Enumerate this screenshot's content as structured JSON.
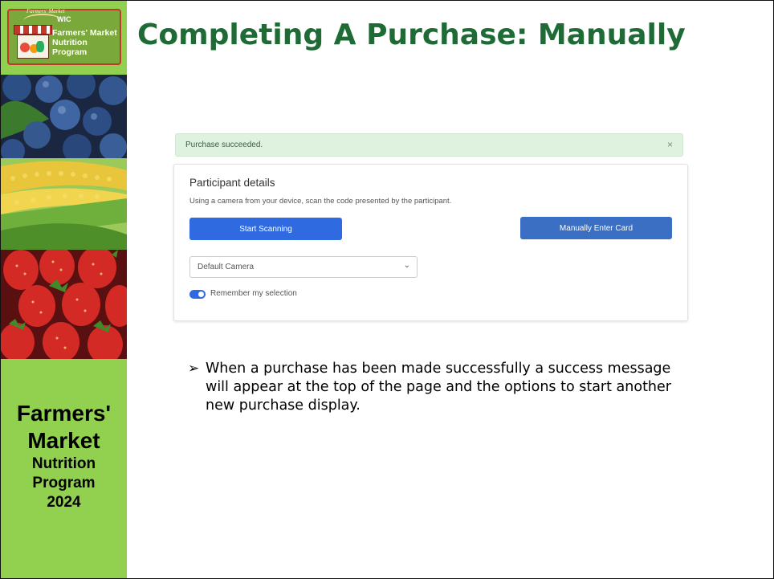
{
  "sidebar": {
    "logo": {
      "arc_text": "Farmers' Market",
      "wic": "WIC",
      "line1": "Farmers' Market",
      "line2": "Nutrition Program"
    },
    "text": {
      "line1": "Farmers'",
      "line2": "Market",
      "line3": "Nutrition",
      "line4": "Program",
      "line5": "2024"
    }
  },
  "title": "Completing A Purchase: Manually",
  "screenshot": {
    "alert": {
      "message": "Purchase succeeded.",
      "close": "×"
    },
    "card": {
      "heading": "Participant details",
      "description": "Using a camera from your device, scan the code presented by the participant.",
      "start_scanning": "Start Scanning",
      "manually_enter": "Manually Enter Card",
      "camera_select": {
        "value": "Default Camera",
        "chevron": "⌄"
      },
      "remember_toggle": {
        "on": true,
        "label": "Remember my selection"
      }
    }
  },
  "bullet": {
    "mark": "➢",
    "text": "When a purchase has been made successfully a success message will appear at the top of the page and the options to start another new purchase display."
  },
  "colors": {
    "sidebar": "#92d050",
    "title": "#1f6b35",
    "button": "#2f6ae0",
    "alert": "#dff2e0"
  }
}
